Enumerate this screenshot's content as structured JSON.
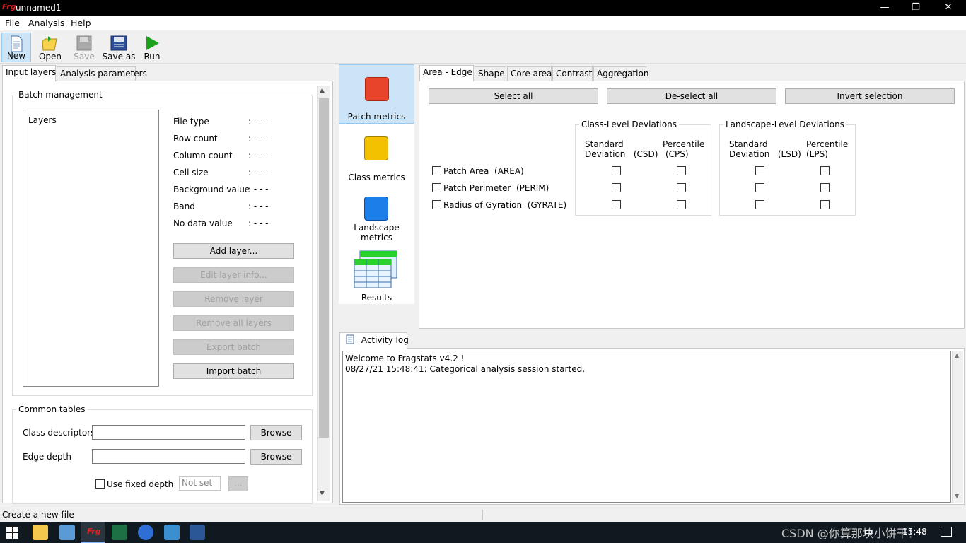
{
  "window": {
    "title": "unnamed1",
    "app_logo": "Frg"
  },
  "menu": [
    "File",
    "Analysis",
    "Help"
  ],
  "toolbar": {
    "new": "New",
    "open": "Open",
    "save": "Save",
    "save_as": "Save as",
    "run": "Run"
  },
  "left_tabs": [
    "Input layers",
    "Analysis parameters"
  ],
  "batch": {
    "title": "Batch management",
    "layers_label": "Layers",
    "info": [
      {
        "label": "File type",
        "value": ": - - -"
      },
      {
        "label": "Row count",
        "value": ": - - -"
      },
      {
        "label": "Column count",
        "value": ": - - -"
      },
      {
        "label": "Cell size",
        "value": ": - - -"
      },
      {
        "label": "Background value",
        "value": ": - - -"
      },
      {
        "label": "Band",
        "value": ": - - -"
      },
      {
        "label": "No data value",
        "value": ": - - -"
      }
    ],
    "buttons": {
      "add": "Add layer...",
      "edit": "Edit layer info...",
      "remove": "Remove layer",
      "remove_all": "Remove all layers",
      "export": "Export batch",
      "import": "Import batch"
    }
  },
  "common_tables": {
    "title": "Common tables",
    "class_descriptors": "Class descriptors",
    "edge_depth": "Edge depth",
    "browse": "Browse",
    "use_fixed_depth": "Use fixed depth",
    "not_set": "Not set",
    "ellipsis": "..."
  },
  "sidebar": {
    "patch": "Patch metrics",
    "class": "Class metrics",
    "landscape": "Landscape metrics",
    "results": "Results"
  },
  "metric_tabs": [
    "Area - Edge",
    "Shape",
    "Core area",
    "Contrast",
    "Aggregation"
  ],
  "selection": {
    "select_all": "Select all",
    "deselect_all": "De-select all",
    "invert": "Invert selection"
  },
  "class_dev": {
    "title": "Class-Level Deviations",
    "col1_a": "Standard",
    "col1_b": "Deviation   (CSD)",
    "col2_a": "Percentile",
    "col2_b": "(CPS)"
  },
  "land_dev": {
    "title": "Landscape-Level Deviations",
    "col1_a": "Standard",
    "col1_b": "Deviation   (LSD)",
    "col2_a": "Percentile",
    "col2_b": "(LPS)"
  },
  "metrics": [
    "Patch Area  (AREA)",
    "Patch Perimeter  (PERIM)",
    "Radius of Gyration  (GYRATE)"
  ],
  "activity": {
    "tab": "Activity log",
    "lines": [
      "Welcome to Fragstats v4.2 !",
      "08/27/21 15:48:41: Categorical analysis session started."
    ]
  },
  "status": "Create a new file",
  "taskbar": {
    "watermark": "CSDN @你算那块小饼干！",
    "lang": "中",
    "time": "15:48"
  },
  "colors": {
    "patch": "#e8442a",
    "class": "#f2c200",
    "landscape": "#1a7fe8",
    "run": "#1aa31a",
    "accent": "#cce4f7"
  }
}
